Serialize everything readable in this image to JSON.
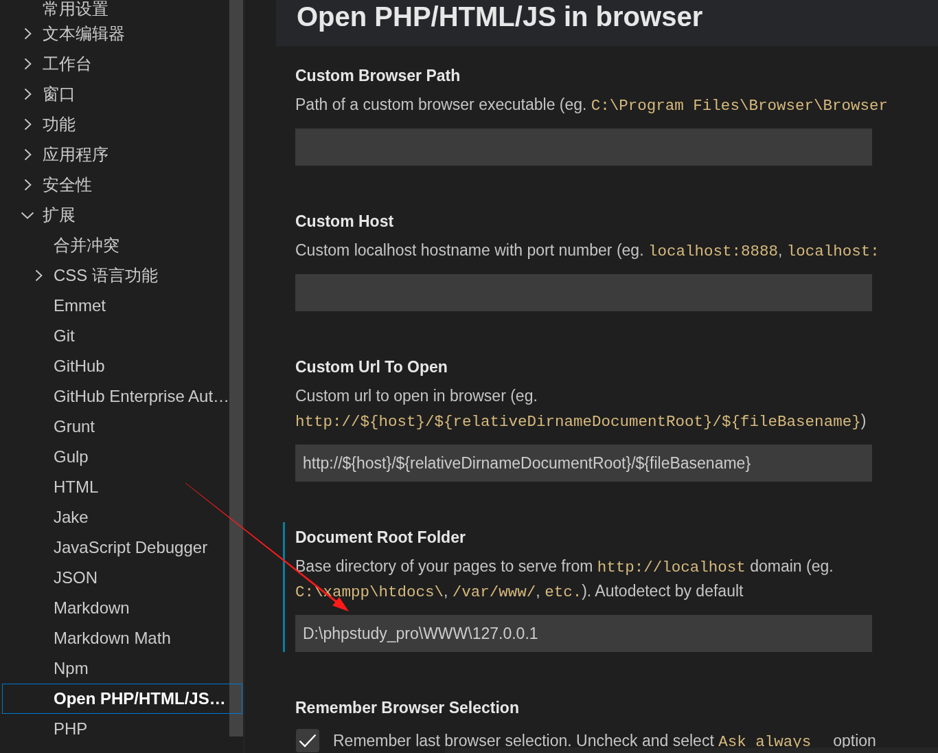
{
  "sidebar": {
    "items": [
      {
        "label": "常用设置",
        "selected": false
      },
      {
        "label": "文本编辑器",
        "expanded": false,
        "selected": false
      },
      {
        "label": "工作台",
        "expanded": false,
        "selected": false
      },
      {
        "label": "窗口",
        "expanded": false,
        "selected": false
      },
      {
        "label": "功能",
        "expanded": false,
        "selected": false
      },
      {
        "label": "应用程序",
        "expanded": false,
        "selected": false
      },
      {
        "label": "安全性",
        "expanded": false,
        "selected": false
      },
      {
        "label": "扩展",
        "expanded": true,
        "selected": false,
        "children": [
          {
            "label": "合并冲突",
            "selected": false
          },
          {
            "label": "CSS 语言功能",
            "expanded": false,
            "selected": false
          },
          {
            "label": "Emmet",
            "selected": false
          },
          {
            "label": "Git",
            "selected": false
          },
          {
            "label": "GitHub",
            "selected": false
          },
          {
            "label": "GitHub Enterprise Aut…",
            "selected": false
          },
          {
            "label": "Grunt",
            "selected": false
          },
          {
            "label": "Gulp",
            "selected": false
          },
          {
            "label": "HTML",
            "selected": false
          },
          {
            "label": "Jake",
            "selected": false
          },
          {
            "label": "JavaScript Debugger",
            "selected": false
          },
          {
            "label": "JSON",
            "selected": false
          },
          {
            "label": "Markdown",
            "selected": false
          },
          {
            "label": "Markdown Math",
            "selected": false
          },
          {
            "label": "Npm",
            "selected": false
          },
          {
            "label": "Open PHP/HTML/JS…",
            "selected": true
          },
          {
            "label": "PHP",
            "selected": false
          }
        ]
      }
    ]
  },
  "header": {
    "title": "Open PHP/HTML/JS in browser"
  },
  "settings": [
    {
      "kind": "text",
      "title": "Custom Browser Path",
      "modified": false,
      "description": [
        [
          {
            "kind": "text",
            "text": "Path of a custom browser executable (eg. "
          },
          {
            "kind": "code",
            "text": "C:\\Program Files\\Browser\\Browser"
          }
        ]
      ]
    },
    {
      "kind": "text",
      "title": "Custom Host",
      "modified": false,
      "description": [
        [
          {
            "kind": "text",
            "text": "Custom localhost hostname with port number (eg. "
          },
          {
            "kind": "code",
            "text": "localhost:8888"
          },
          {
            "kind": "text",
            "text": ", "
          },
          {
            "kind": "code",
            "text": "localhost:"
          }
        ]
      ]
    },
    {
      "kind": "text",
      "title": "Custom Url To Open",
      "modified": false,
      "description": [
        [
          {
            "kind": "text",
            "text": "Custom url to open in browser (eg."
          }
        ],
        [
          {
            "kind": "code",
            "text": "http://${host}/${relativeDirnameDocumentRoot}/${fileBasename}"
          },
          {
            "kind": "text",
            "text": ")"
          }
        ]
      ],
      "value": "http://${host}/${relativeDirnameDocumentRoot}/${fileBasename}"
    },
    {
      "kind": "text",
      "title": "Document Root Folder",
      "modified": true,
      "description": [
        [
          {
            "kind": "text",
            "text": "Base directory of your pages to serve from "
          },
          {
            "kind": "code",
            "text": "http://localhost"
          },
          {
            "kind": "text",
            "text": " domain (eg."
          }
        ],
        [
          {
            "kind": "code",
            "text": "C:\\xampp\\htdocs\\"
          },
          {
            "kind": "text",
            "text": ", "
          },
          {
            "kind": "code",
            "text": "/var/www/"
          },
          {
            "kind": "text",
            "text": ", "
          },
          {
            "kind": "code",
            "text": "etc."
          },
          {
            "kind": "text",
            "text": "). Autodetect by default"
          }
        ]
      ],
      "value": "D:\\phpstudy_pro\\WWW\\127.0.0.1"
    },
    {
      "kind": "checkbox",
      "title": "Remember Browser Selection",
      "modified": false,
      "checked": true,
      "description": [
        [
          {
            "kind": "text",
            "text": "Remember last browser selection. Uncheck and select "
          },
          {
            "kind": "code",
            "text": "Ask always"
          },
          {
            "kind": "text",
            "text": "     option"
          }
        ]
      ]
    }
  ]
}
